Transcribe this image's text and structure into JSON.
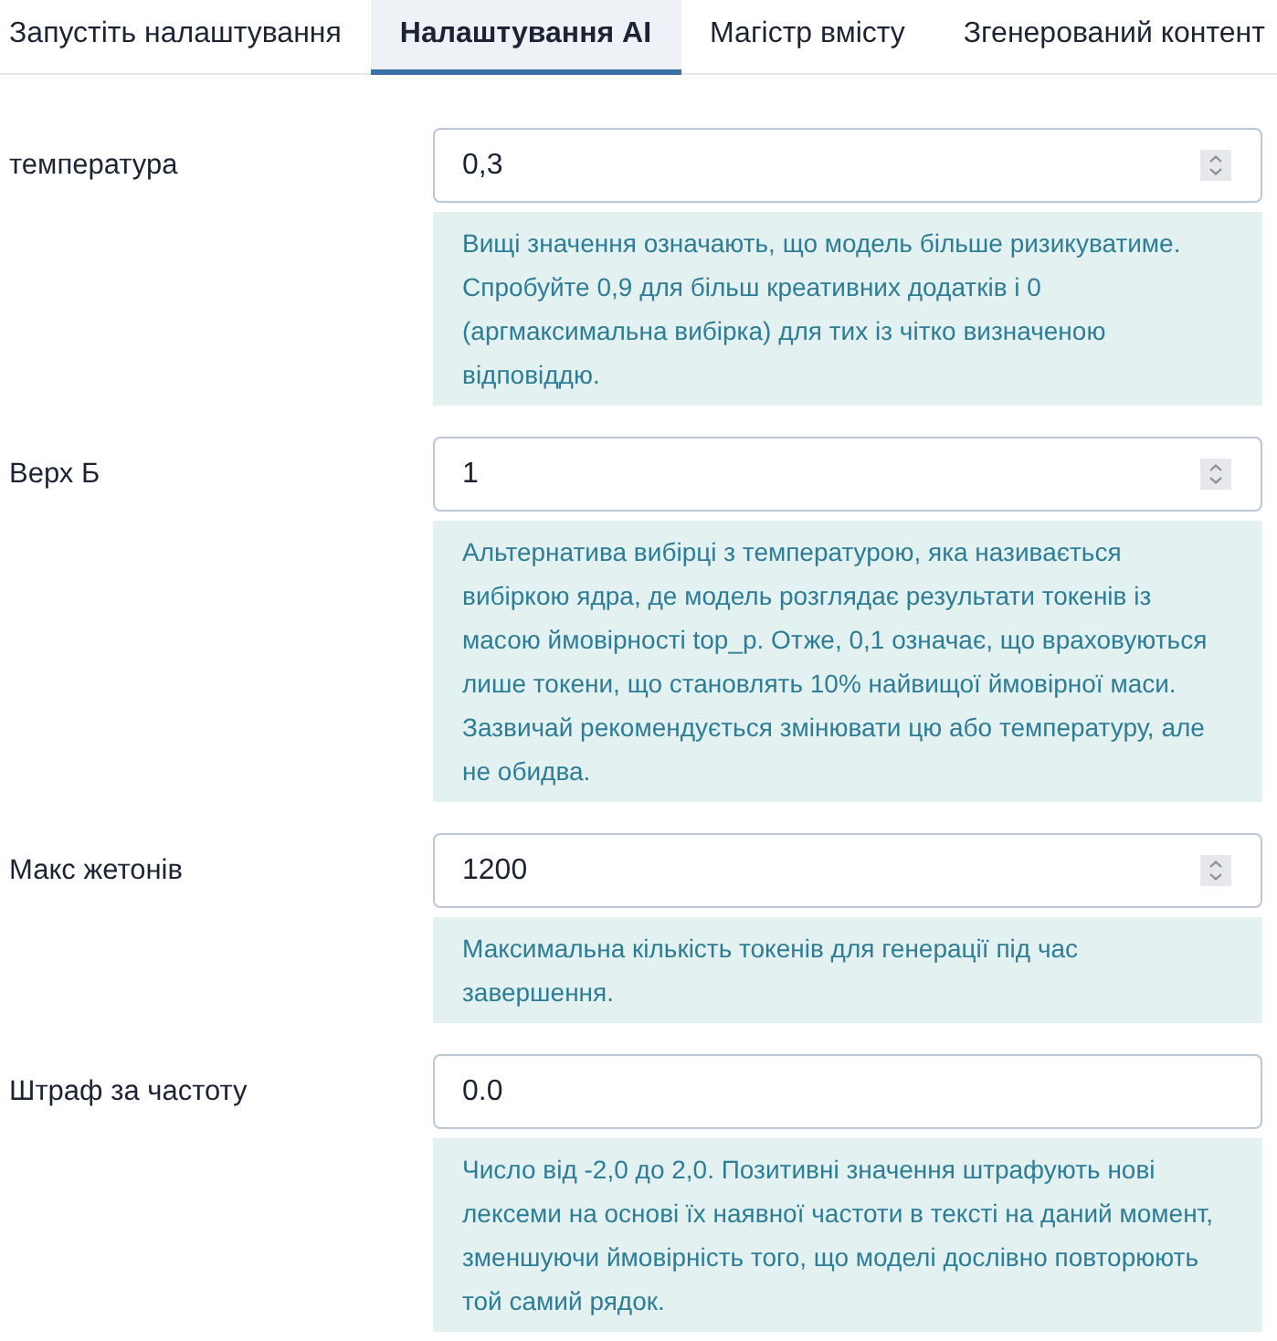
{
  "tabs": [
    {
      "label": "Запустіть налаштування",
      "selected": false
    },
    {
      "label": "Налаштування AI",
      "selected": true
    },
    {
      "label": "Магістр вмісту",
      "selected": false
    },
    {
      "label": "Згенерований контент",
      "selected": false
    }
  ],
  "fields": [
    {
      "label": "температура",
      "kind": "number",
      "value": "0,3",
      "help": "Вищі значення означають, що модель більше ризикуватиме. Спробуйте 0,9 для більш креативних додатків і 0 (аргмаксимальна вибірка) для тих із чітко визначеною відповіддю."
    },
    {
      "label": "Верх Б",
      "kind": "number",
      "value": "1",
      "help": "Альтернатива вибірці з температурою, яка називається вибіркою ядра, де модель розглядає результати токенів із масою ймовірності top_p. Отже, 0,1 означає, що враховуються лише токени, що становлять 10% найвищої ймовірної маси. Зазвичай рекомендується змінювати цю або температуру, але не обидва."
    },
    {
      "label": "Макс жетонів",
      "kind": "number",
      "value": "1200",
      "help": "Максимальна кількість токенів для генерації під час завершення."
    },
    {
      "label": "Штраф за частоту",
      "kind": "text",
      "value": "0.0",
      "help": "Число від -2,0 до 2,0. Позитивні значення штрафують нові лексеми на основі їх наявної частоти в тексті на даний момент, зменшуючи ймовірність того, що моделі дослівно повторюють той самий рядок."
    }
  ]
}
